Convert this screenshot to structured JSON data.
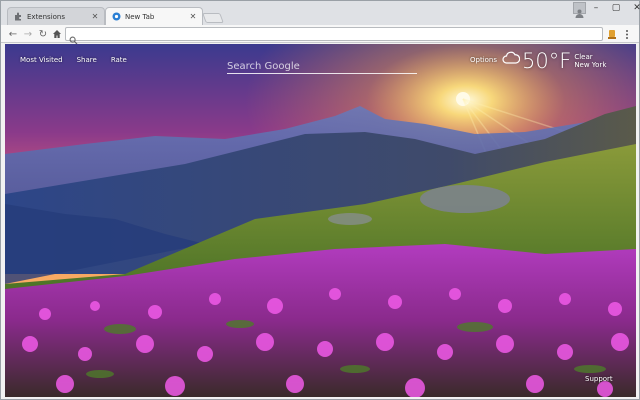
{
  "browser": {
    "tabs": [
      {
        "label": "Extensions",
        "active": false
      },
      {
        "label": "New Tab",
        "active": true
      }
    ],
    "omnibox_value": "",
    "window_controls": [
      "minimize",
      "maximize",
      "close"
    ]
  },
  "newtab": {
    "links": {
      "most_visited": "Most Visited",
      "share": "Share",
      "rate": "Rate"
    },
    "search_placeholder": "Search Google",
    "options_label": "Options",
    "weather": {
      "temperature": "50°F",
      "condition": "Clear",
      "city": "New York",
      "icon": "cloud-icon"
    },
    "support_label": "Support"
  },
  "colors": {
    "tabstrip": "#dfe1e5",
    "toolbar": "#f7f7f7",
    "sky_top": "#4a3f8f",
    "sunset": "#ffb347",
    "flowers": "#d62fd0",
    "grass": "#5f8f2a"
  }
}
